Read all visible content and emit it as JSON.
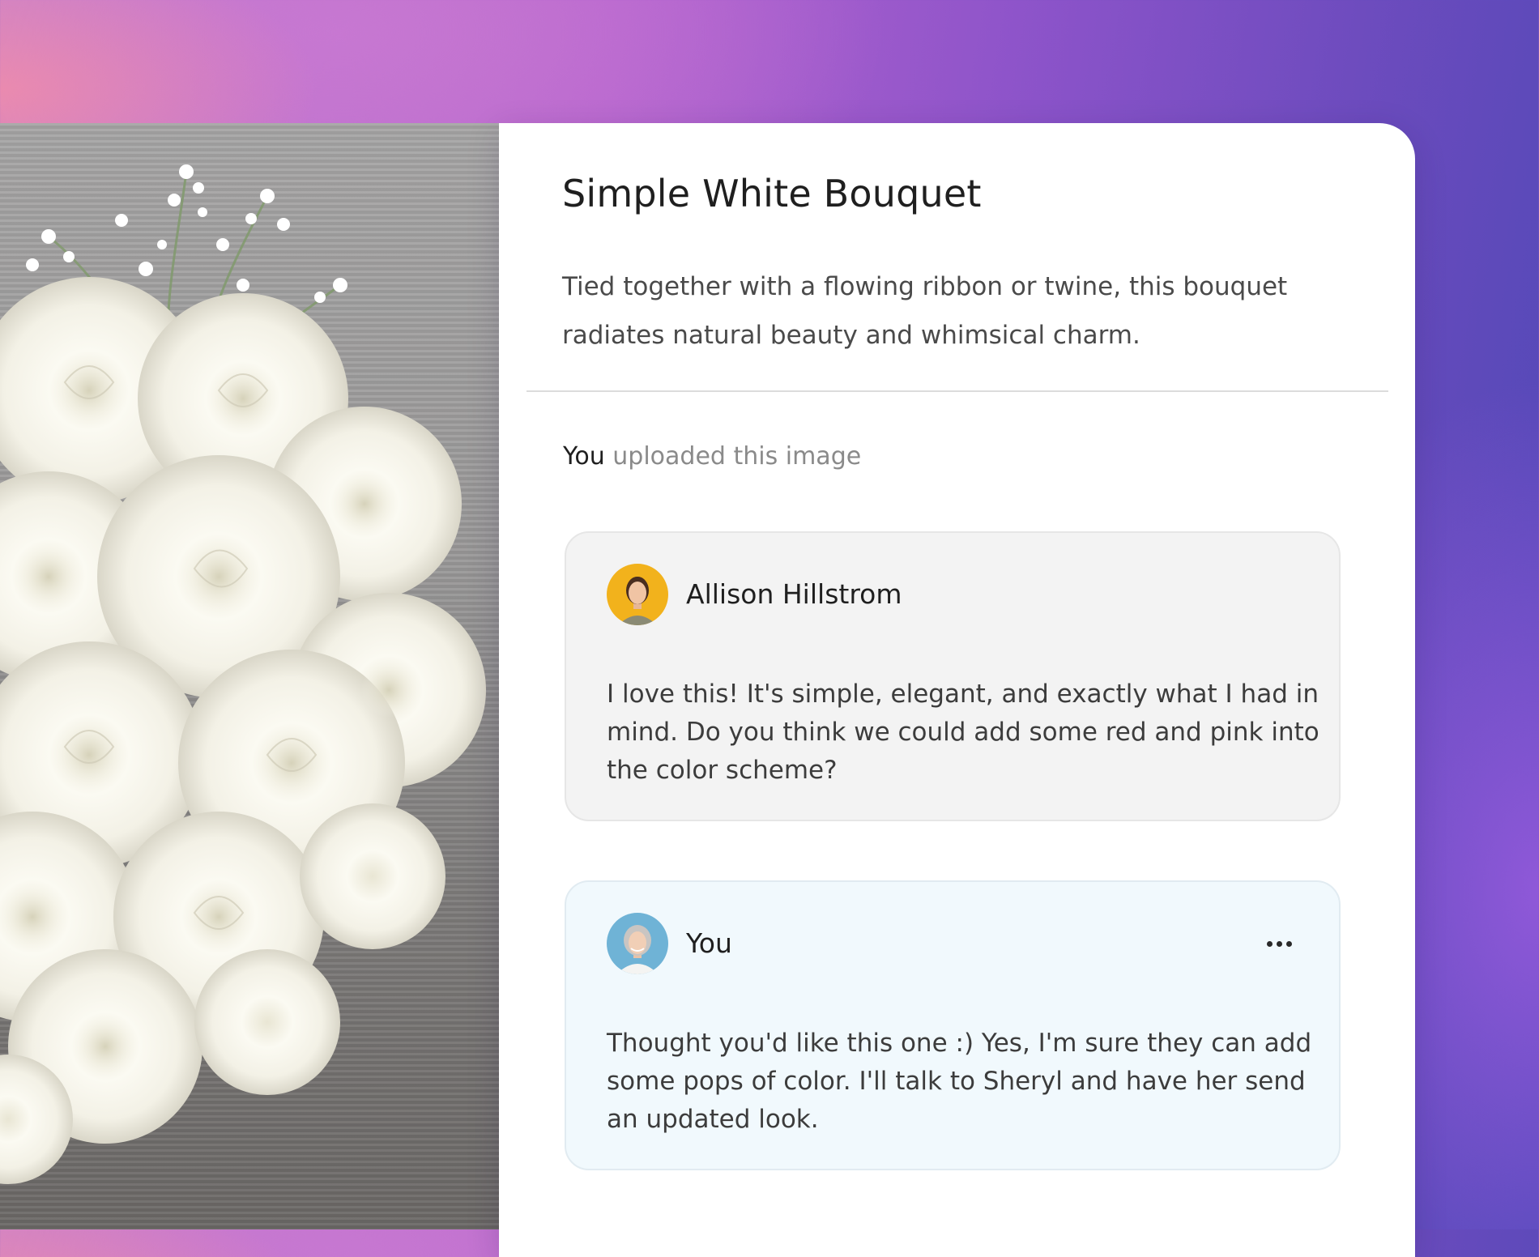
{
  "post": {
    "title": "Simple White Bouquet",
    "description": "Tied together with a flowing ribbon or twine, this bouquet radiates natural beauty and whimsical charm."
  },
  "activity": {
    "actor": "You",
    "action": "uploaded this image"
  },
  "comments": [
    {
      "author": "Allison Hillstrom",
      "avatar_icon": "user-avatar-photo",
      "text": "I love this! It's simple, elegant, and exactly what I had in mind. Do you think we could add some red and pink into the color scheme?"
    },
    {
      "author": "You",
      "avatar_icon": "user-avatar-photo",
      "text": "Thought you'd like this one :) Yes, I'm sure they can add some pops of color. I'll talk to Sheryl and have her send an updated look.",
      "menu_icon": "more-horizontal-icon"
    }
  ],
  "colors": {
    "card_background": "#ffffff",
    "comment_background": "#f3f3f3",
    "own_comment_background": "#f1f9fd",
    "muted_text": "#8a8a8a",
    "gradient_pink": "#c885c8",
    "gradient_purple": "#8b53c9",
    "gradient_blue": "#4b48b6"
  }
}
